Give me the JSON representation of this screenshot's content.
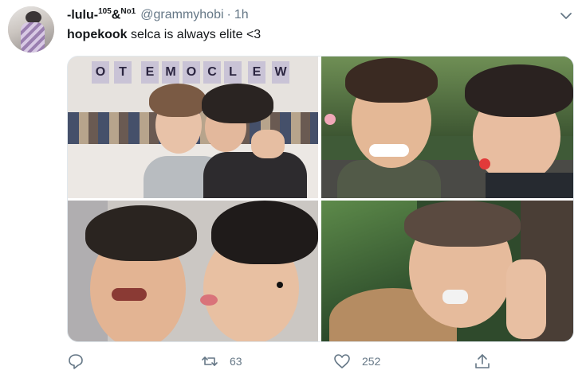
{
  "tweet": {
    "display_name": "-lulu-",
    "name_sup_1": "105",
    "name_amp": "&",
    "name_sup_2": "No1",
    "handle": "@grammyhobi",
    "separator": "·",
    "time": "1h",
    "text_bold": "hopekook",
    "text_rest": " selca is always elite <3"
  },
  "photo1_sign": [
    "O",
    "T",
    "E",
    "M",
    "O",
    "C",
    "L",
    "E",
    "W"
  ],
  "actions": {
    "reply_icon": "reply-icon",
    "retweet_icon": "retweet-icon",
    "retweet_count": "63",
    "like_icon": "heart-icon",
    "like_count": "252",
    "share_icon": "share-icon"
  }
}
